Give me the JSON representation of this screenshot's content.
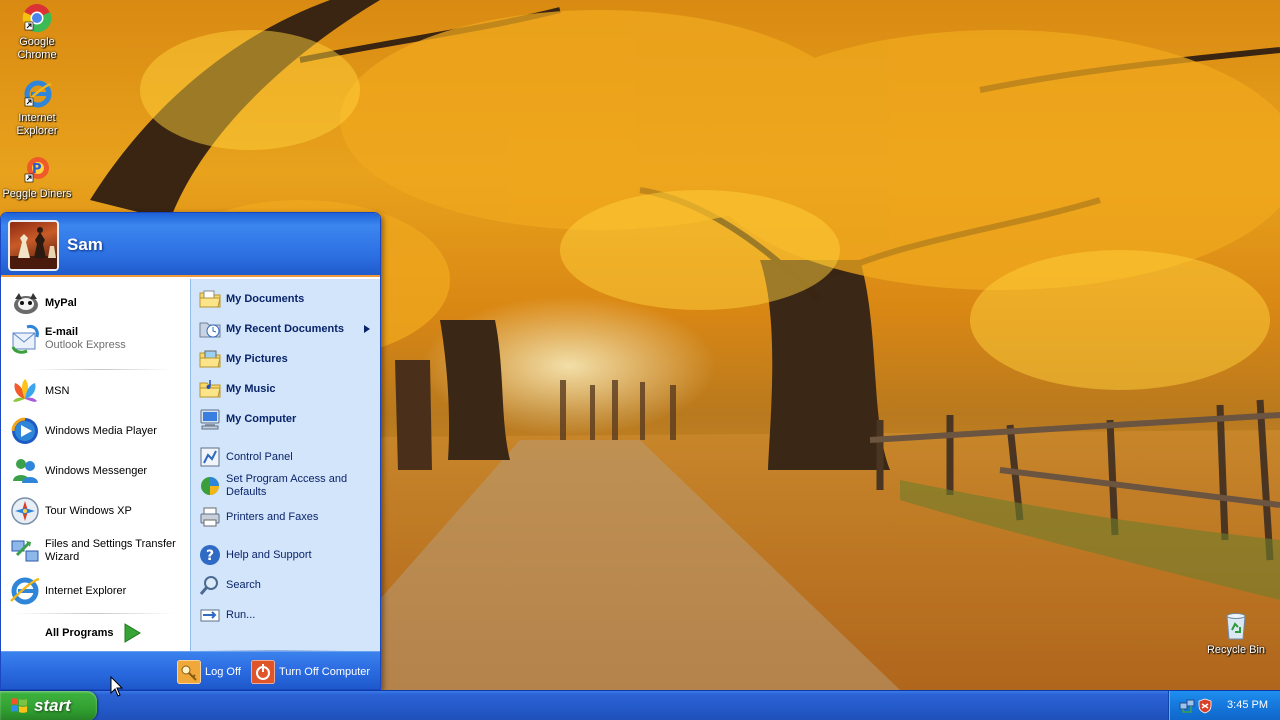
{
  "desktop": {
    "icons": [
      {
        "label": "Google Chrome",
        "icon": "chrome-icon"
      },
      {
        "label": "Internet Explorer",
        "icon": "ie-icon"
      },
      {
        "label": "Peggle Diners",
        "icon": "peggle-icon"
      },
      {
        "label": "Recycle Bin",
        "icon": "recycle-bin-icon"
      }
    ]
  },
  "start_menu": {
    "user_name": "Sam",
    "pinned": [
      {
        "label": "MyPal",
        "sub": "",
        "icon": "mypal-icon"
      },
      {
        "label": "E-mail",
        "sub": "Outlook Express",
        "icon": "email-icon"
      }
    ],
    "recent": [
      {
        "label": "MSN",
        "icon": "msn-icon"
      },
      {
        "label": "Windows Media Player",
        "icon": "media-player-icon"
      },
      {
        "label": "Windows Messenger",
        "icon": "messenger-icon"
      },
      {
        "label": "Tour Windows XP",
        "icon": "tour-icon"
      },
      {
        "label": "Files and Settings Transfer Wizard",
        "icon": "transfer-wizard-icon"
      },
      {
        "label": "Internet Explorer",
        "icon": "ie-icon"
      }
    ],
    "all_programs": "All Programs",
    "places": [
      {
        "label": "My Documents",
        "icon": "folder-icon"
      },
      {
        "label": "My Recent Documents",
        "icon": "recent-docs-icon"
      },
      {
        "label": "My Pictures",
        "icon": "pictures-folder-icon"
      },
      {
        "label": "My Music",
        "icon": "music-folder-icon"
      },
      {
        "label": "My Computer",
        "icon": "computer-icon"
      }
    ],
    "settings": [
      {
        "label": "Control Panel",
        "icon": "control-panel-icon"
      },
      {
        "label": "Set Program Access and Defaults",
        "icon": "program-access-icon"
      },
      {
        "label": "Printers and Faxes",
        "icon": "printer-icon"
      }
    ],
    "tools": [
      {
        "label": "Help and Support",
        "icon": "help-icon"
      },
      {
        "label": "Search",
        "icon": "search-icon"
      },
      {
        "label": "Run...",
        "icon": "run-icon"
      }
    ],
    "log_off": "Log Off",
    "turn_off": "Turn Off Computer"
  },
  "taskbar": {
    "start_label": "start",
    "clock": "3:45 PM"
  },
  "colors": {
    "taskbar_blue": "#245edb",
    "start_green": "#3a9f3a",
    "menu_right_panel": "#d3e5fa",
    "menu_header_blue": "#2c6fe2"
  }
}
